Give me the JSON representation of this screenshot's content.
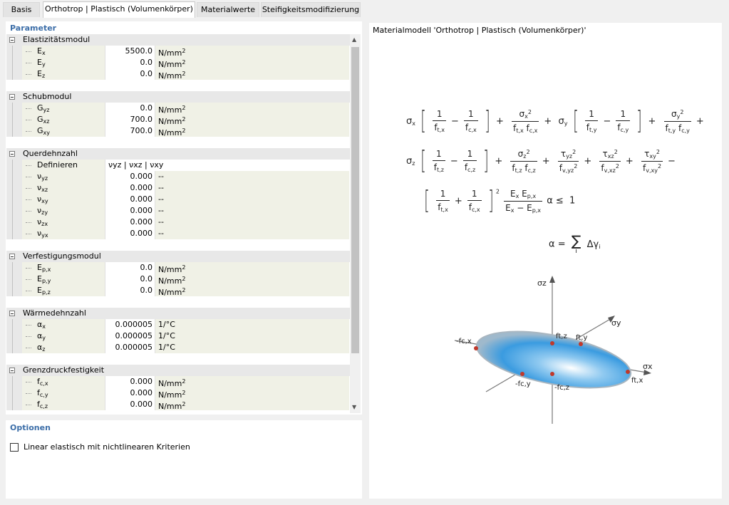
{
  "tabs": [
    {
      "label": "Basis",
      "active": false
    },
    {
      "label": "Orthotrop | Plastisch (Volumenkörper)",
      "active": true
    },
    {
      "label": "Materialwerte",
      "active": false
    },
    {
      "label": "Steifigkeitsmodifizierung",
      "active": false
    }
  ],
  "parameter": {
    "title": "Parameter",
    "groups": [
      {
        "label": "Elastizitätsmodul",
        "rows": [
          {
            "name": "E",
            "sub": "x",
            "value": "5500.0",
            "unit": "N/mm",
            "sup": "2"
          },
          {
            "name": "E",
            "sub": "y",
            "value": "0.0",
            "unit": "N/mm",
            "sup": "2"
          },
          {
            "name": "E",
            "sub": "z",
            "value": "0.0",
            "unit": "N/mm",
            "sup": "2"
          }
        ]
      },
      {
        "label": "Schubmodul",
        "rows": [
          {
            "name": "G",
            "sub": "yz",
            "value": "0.0",
            "unit": "N/mm",
            "sup": "2"
          },
          {
            "name": "G",
            "sub": "xz",
            "value": "700.0",
            "unit": "N/mm",
            "sup": "2"
          },
          {
            "name": "G",
            "sub": "xy",
            "value": "700.0",
            "unit": "N/mm",
            "sup": "2"
          }
        ]
      },
      {
        "label": "Querdehnzahl",
        "definieren": {
          "name": "Definieren",
          "value": "νyz | νxz | νxy"
        },
        "rows": [
          {
            "name": "ν",
            "sub": "yz",
            "value": "0.000",
            "unit": "--",
            "sup": ""
          },
          {
            "name": "ν",
            "sub": "xz",
            "value": "0.000",
            "unit": "--",
            "sup": ""
          },
          {
            "name": "ν",
            "sub": "xy",
            "value": "0.000",
            "unit": "--",
            "sup": ""
          },
          {
            "name": "ν",
            "sub": "zy",
            "value": "0.000",
            "unit": "--",
            "sup": ""
          },
          {
            "name": "ν",
            "sub": "zx",
            "value": "0.000",
            "unit": "--",
            "sup": ""
          },
          {
            "name": "ν",
            "sub": "yx",
            "value": "0.000",
            "unit": "--",
            "sup": ""
          }
        ]
      },
      {
        "label": "Verfestigungsmodul",
        "rows": [
          {
            "name": "E",
            "sub": "p,x",
            "value": "0.0",
            "unit": "N/mm",
            "sup": "2"
          },
          {
            "name": "E",
            "sub": "p,y",
            "value": "0.0",
            "unit": "N/mm",
            "sup": "2"
          },
          {
            "name": "E",
            "sub": "p,z",
            "value": "0.0",
            "unit": "N/mm",
            "sup": "2"
          }
        ]
      },
      {
        "label": "Wärmedehnzahl",
        "rows": [
          {
            "name": "α",
            "sub": "x",
            "value": "0.000005",
            "unit": "1/°C",
            "sup": ""
          },
          {
            "name": "α",
            "sub": "y",
            "value": "0.000005",
            "unit": "1/°C",
            "sup": ""
          },
          {
            "name": "α",
            "sub": "z",
            "value": "0.000005",
            "unit": "1/°C",
            "sup": ""
          }
        ]
      },
      {
        "label": "Grenzdruckfestigkeit",
        "rows": [
          {
            "name": "f",
            "sub": "c,x",
            "value": "0.000",
            "unit": "N/mm",
            "sup": "2"
          },
          {
            "name": "f",
            "sub": "c,y",
            "value": "0.000",
            "unit": "N/mm",
            "sup": "2"
          },
          {
            "name": "f",
            "sub": "c,z",
            "value": "0.000",
            "unit": "N/mm",
            "sup": "2"
          }
        ]
      }
    ]
  },
  "options": {
    "title": "Optionen",
    "checkbox_label": "Linear elastisch mit nichtlinearen Kriterien",
    "checked": false
  },
  "preview": {
    "title": "Materialmodell 'Orthotrop | Plastisch (Volumenkörper)'",
    "formula": {
      "one": "1",
      "two": "2",
      "plus": "+",
      "minus": "−",
      "leq": "≤",
      "alpha": "α",
      "sum": "∑",
      "i": "i",
      "dgamma": "Δγ",
      "eq": "=",
      "sx": "σ",
      "sy": "σ",
      "sz": "σ",
      "tau": "τ",
      "E": "E",
      "f": "f"
    },
    "diagram": {
      "axis_z": "σz",
      "axis_y": "σy",
      "axis_x": "σx",
      "labels": [
        "-fc,x",
        "ft,z",
        "ft,y",
        "ft,x",
        "-fc,y",
        "-fc,z"
      ]
    }
  },
  "colors": {
    "accent": "#3c6ea8",
    "point": "#c0392b"
  }
}
